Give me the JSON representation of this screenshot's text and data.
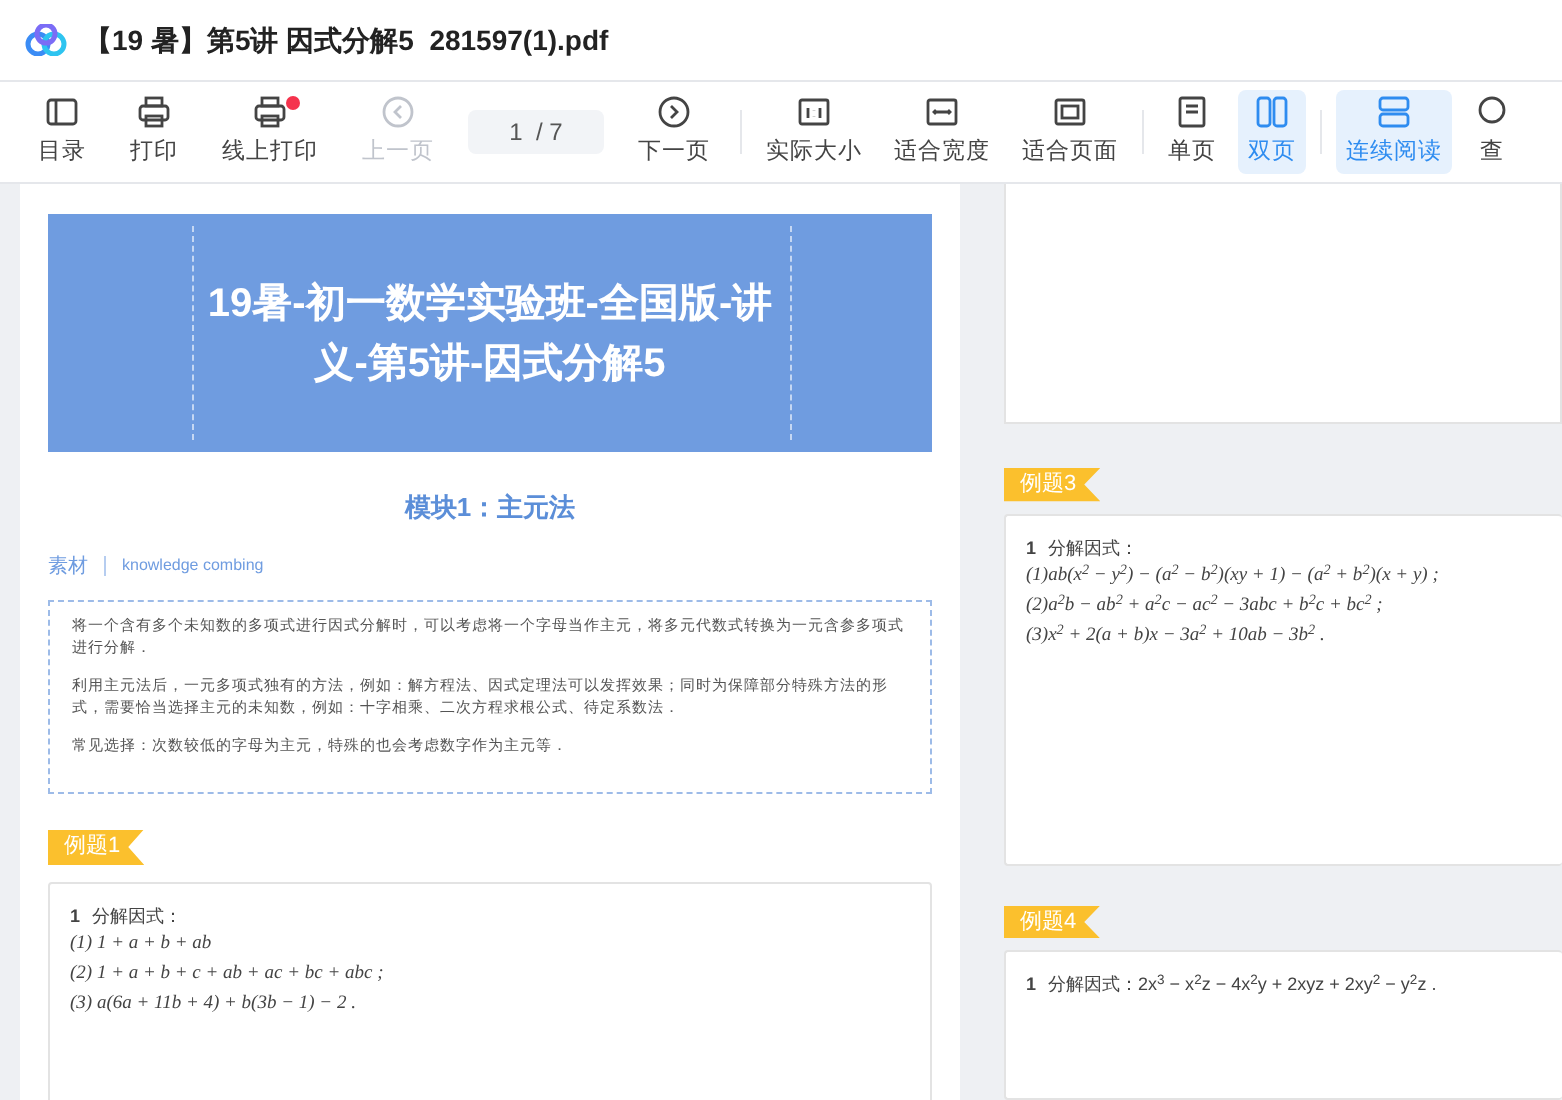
{
  "window": {
    "title": "【19 暑】第5讲 因式分解5  281597(1).pdf"
  },
  "toolbar": {
    "groups": [
      [
        {
          "kind": "button",
          "label": "目录",
          "disabled": false,
          "selected": false
        },
        {
          "kind": "button",
          "label": "打印",
          "disabled": false,
          "selected": false
        },
        {
          "kind": "button",
          "label": "线上打印",
          "disabled": false,
          "selected": false,
          "badge": true
        },
        {
          "kind": "button",
          "label": "上一页",
          "disabled": true,
          "selected": false
        },
        {
          "kind": "page",
          "value": "1  / 7"
        },
        {
          "kind": "button",
          "label": "下一页",
          "disabled": false,
          "selected": false
        }
      ],
      [
        {
          "kind": "button",
          "label": "实际大小",
          "disabled": false,
          "selected": false
        },
        {
          "kind": "button",
          "label": "适合宽度",
          "disabled": false,
          "selected": false
        },
        {
          "kind": "button",
          "label": "适合页面",
          "disabled": false,
          "selected": false
        }
      ],
      [
        {
          "kind": "button",
          "label": "单页",
          "disabled": false,
          "selected": false
        },
        {
          "kind": "button",
          "label": "双页",
          "disabled": false,
          "selected": true
        }
      ],
      [
        {
          "kind": "button",
          "label": "连续阅读",
          "disabled": false,
          "selected": true
        },
        {
          "kind": "button",
          "label": "查",
          "disabled": false,
          "selected": false
        }
      ]
    ]
  },
  "left_page": {
    "banner_title": "19暑-初一数学实验班-全国版-讲义-第5讲-因式分解5",
    "module_heading": "模块1：主元法",
    "section_label": "素材",
    "section_subtitle": "knowledge combing",
    "paragraphs": [
      "将一个含有多个未知数的多项式进行因式分解时，可以考虑将一个字母当作主元，将多元代数式转换为一元含参多项式进行分解．",
      "利用主元法后，一元多项式独有的方法，例如：解方程法、因式定理法可以发挥效果；同时为保障部分特殊方法的形式，需要恰当选择主元的未知数，例如：十字相乘、二次方程求根公式、待定系数法．",
      "常见选择：次数较低的字母为主元，特殊的也会考虑数字作为主元等．"
    ],
    "examples": [
      {
        "tag": "例题1",
        "number": "1",
        "prompt": "分解因式：",
        "lines": [
          "(1) 1 + a + b + ab",
          "(2) 1 + a + b + c + ab + ac + bc + abc ;",
          "(3) a(6a + 11b + 4) + b(3b − 1) − 2 ."
        ]
      }
    ]
  },
  "right_page": {
    "examples": [
      {
        "tag": "例题3",
        "number": "1",
        "prompt": "分解因式：",
        "lines": [
          "(1)ab(x$^{2}$ − y$^{2}$) − (a$^{2}$ − b$^{2}$)(xy + 1) − (a$^{2}$ + b$^{2}$)(x + y) ;",
          "(2)a$^{2}$b − ab$^{2}$ + a$^{2}$c − ac$^{2}$ − 3abc + b$^{2}$c + bc$^{2}$ ;",
          "(3)x$^{2}$ + 2(a + b)x − 3a$^{2}$ + 10ab − 3b$^{2}$ ."
        ]
      },
      {
        "tag": "例题4",
        "number": "1",
        "prompt": "分解因式：2x$^{3}$ − x$^{2}$z − 4x$^{2}$y + 2xyz + 2xy$^{2}$ − y$^{2}$z ."
      }
    ]
  }
}
